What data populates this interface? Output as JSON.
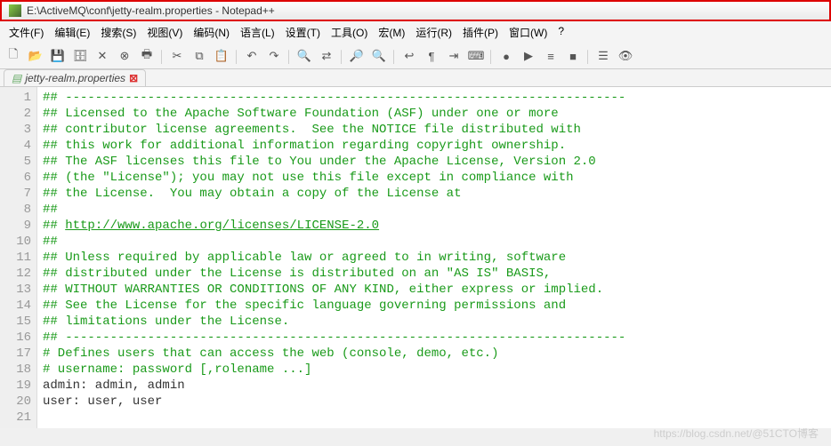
{
  "window": {
    "title": "E:\\ActiveMQ\\conf\\jetty-realm.properties - Notepad++"
  },
  "menu": [
    "文件(F)",
    "编辑(E)",
    "搜索(S)",
    "视图(V)",
    "编码(N)",
    "语言(L)",
    "设置(T)",
    "工具(O)",
    "宏(M)",
    "运行(R)",
    "插件(P)",
    "窗口(W)",
    "?"
  ],
  "tab": {
    "label": "jetty-realm.properties",
    "dirty": "⊠"
  },
  "code_lines": [
    {
      "n": 1,
      "cls": "cm",
      "text": "## ---------------------------------------------------------------------------"
    },
    {
      "n": 2,
      "cls": "cm",
      "text": "## Licensed to the Apache Software Foundation (ASF) under one or more"
    },
    {
      "n": 3,
      "cls": "cm",
      "text": "## contributor license agreements.  See the NOTICE file distributed with"
    },
    {
      "n": 4,
      "cls": "cm",
      "text": "## this work for additional information regarding copyright ownership."
    },
    {
      "n": 5,
      "cls": "cm",
      "text": "## The ASF licenses this file to You under the Apache License, Version 2.0"
    },
    {
      "n": 6,
      "cls": "cm",
      "text": "## (the \"License\"); you may not use this file except in compliance with"
    },
    {
      "n": 7,
      "cls": "cm",
      "text": "## the License.  You may obtain a copy of the License at"
    },
    {
      "n": 8,
      "cls": "cm",
      "text": "##"
    },
    {
      "n": 9,
      "cls": "cm",
      "pre": "## ",
      "link": "http://www.apache.org/licenses/LICENSE-2.0"
    },
    {
      "n": 10,
      "cls": "cm",
      "text": "##"
    },
    {
      "n": 11,
      "cls": "cm",
      "text": "## Unless required by applicable law or agreed to in writing, software"
    },
    {
      "n": 12,
      "cls": "cm",
      "text": "## distributed under the License is distributed on an \"AS IS\" BASIS,"
    },
    {
      "n": 13,
      "cls": "cm",
      "text": "## WITHOUT WARRANTIES OR CONDITIONS OF ANY KIND, either express or implied."
    },
    {
      "n": 14,
      "cls": "cm",
      "text": "## See the License for the specific language governing permissions and"
    },
    {
      "n": 15,
      "cls": "cm",
      "text": "## limitations under the License."
    },
    {
      "n": 16,
      "cls": "cm",
      "text": "## ---------------------------------------------------------------------------"
    },
    {
      "n": 17,
      "cls": "plain",
      "text": ""
    },
    {
      "n": 18,
      "cls": "cm",
      "text": "# Defines users that can access the web (console, demo, etc.)"
    },
    {
      "n": 19,
      "cls": "cm",
      "text": "# username: password [,rolename ...]"
    },
    {
      "n": 20,
      "cls": "plain",
      "text": "admin: admin, admin"
    },
    {
      "n": 21,
      "cls": "plain",
      "text": "user: user, user"
    }
  ],
  "toolbar_icons": [
    "new",
    "open",
    "save",
    "save-all",
    "close",
    "close-all",
    "print",
    "|",
    "cut",
    "copy",
    "paste",
    "|",
    "undo",
    "redo",
    "|",
    "find",
    "replace",
    "|",
    "zoom-in",
    "zoom-out",
    "|",
    "wrap",
    "chars",
    "indent",
    "lang",
    "|",
    "macro-rec",
    "macro-play",
    "macro-run",
    "macro-stop",
    "|",
    "toggle",
    "eye"
  ],
  "icon_glyphs": {
    "new": "🗋",
    "open": "📂",
    "save": "💾",
    "save-all": "🗄",
    "close": "✕",
    "close-all": "⊗",
    "print": "🖶",
    "cut": "✂",
    "copy": "⧉",
    "paste": "📋",
    "undo": "↶",
    "redo": "↷",
    "find": "🔍",
    "replace": "⇄",
    "zoom-in": "🔎",
    "zoom-out": "🔍",
    "wrap": "↩",
    "chars": "¶",
    "indent": "⇥",
    "lang": "⌨",
    "macro-rec": "●",
    "macro-play": "▶",
    "macro-run": "≡",
    "macro-stop": "■",
    "toggle": "☰",
    "eye": "👁"
  },
  "watermark": "https://blog.csdn.net/@51CTO博客"
}
